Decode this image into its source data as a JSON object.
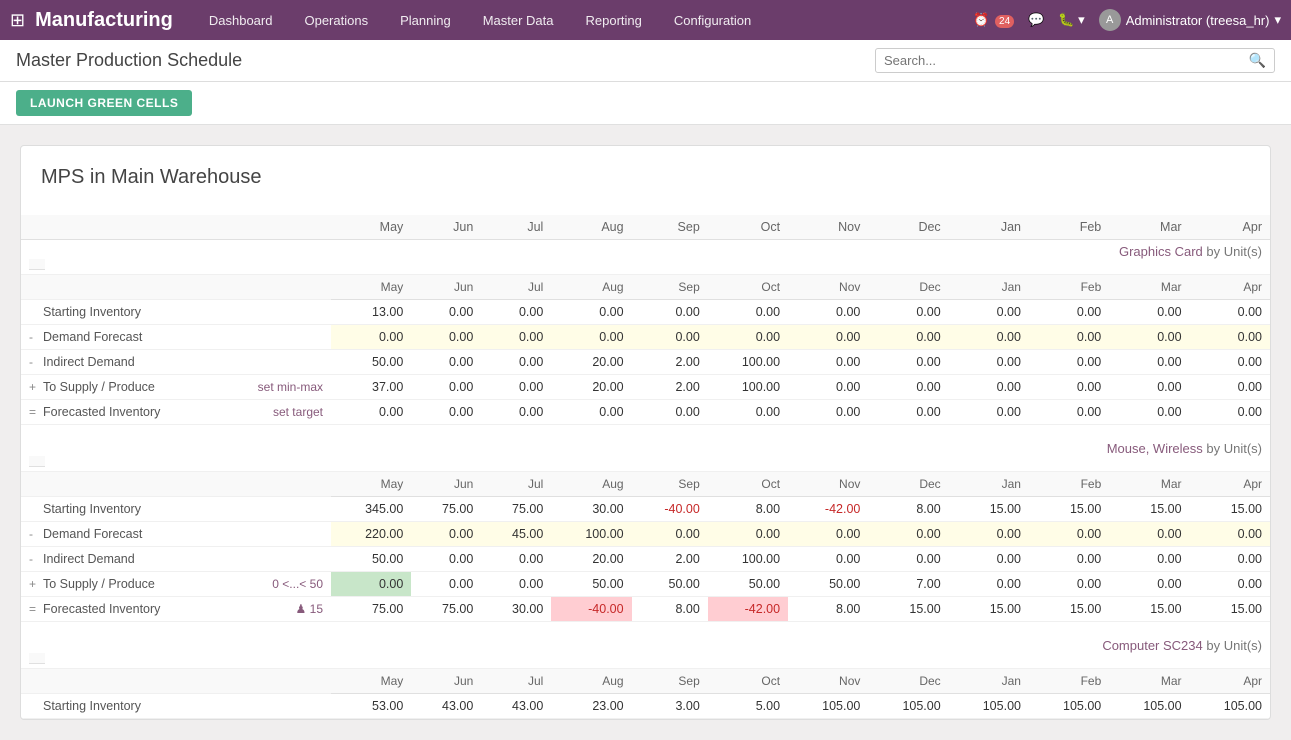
{
  "app": {
    "grid_icon": "⊞",
    "name": "Manufacturing"
  },
  "nav": {
    "items": [
      {
        "label": "Dashboard",
        "key": "dashboard"
      },
      {
        "label": "Operations",
        "key": "operations"
      },
      {
        "label": "Planning",
        "key": "planning"
      },
      {
        "label": "Master Data",
        "key": "master-data"
      },
      {
        "label": "Reporting",
        "key": "reporting"
      },
      {
        "label": "Configuration",
        "key": "configuration"
      }
    ]
  },
  "topright": {
    "activity_count": "24",
    "user_label": "Administrator (treesa_hr)",
    "user_initials": "A"
  },
  "page": {
    "title": "Master Production Schedule",
    "search_placeholder": "Search..."
  },
  "toolbar": {
    "launch_label": "LAUNCH GREEN CELLS"
  },
  "section": {
    "title": "MPS in Main Warehouse"
  },
  "columns": [
    "May",
    "Jun",
    "Jul",
    "Aug",
    "Sep",
    "Oct",
    "Nov",
    "Dec",
    "Jan",
    "Feb",
    "Mar",
    "Apr"
  ],
  "products": [
    {
      "name": "Graphics Card",
      "unit": "Unit(s)",
      "rows": [
        {
          "label": "Starting Inventory",
          "prefix": "",
          "action": "",
          "values": [
            "13.00",
            "0.00",
            "0.00",
            "0.00",
            "0.00",
            "0.00",
            "0.00",
            "0.00",
            "0.00",
            "0.00",
            "0.00",
            "0.00"
          ],
          "highlights": []
        },
        {
          "label": "Demand Forecast",
          "prefix": "-",
          "action": "",
          "values": [
            "0.00",
            "0.00",
            "0.00",
            "0.00",
            "0.00",
            "0.00",
            "0.00",
            "0.00",
            "0.00",
            "0.00",
            "0.00",
            "0.00"
          ],
          "highlights": [
            0,
            1,
            2,
            3,
            4,
            5,
            6,
            7,
            8,
            9,
            10,
            11
          ],
          "highlight_type": "yellow"
        },
        {
          "label": "Indirect Demand",
          "prefix": "-",
          "action": "",
          "values": [
            "50.00",
            "0.00",
            "0.00",
            "20.00",
            "2.00",
            "100.00",
            "0.00",
            "0.00",
            "0.00",
            "0.00",
            "0.00",
            "0.00"
          ],
          "highlights": []
        },
        {
          "label": "To Supply / Produce",
          "prefix": "+",
          "action": "set min-max",
          "values": [
            "37.00",
            "0.00",
            "0.00",
            "20.00",
            "2.00",
            "100.00",
            "0.00",
            "0.00",
            "0.00",
            "0.00",
            "0.00",
            "0.00"
          ],
          "highlights": []
        },
        {
          "label": "Forecasted Inventory",
          "prefix": "=",
          "action": "set target",
          "values": [
            "0.00",
            "0.00",
            "0.00",
            "0.00",
            "0.00",
            "0.00",
            "0.00",
            "0.00",
            "0.00",
            "0.00",
            "0.00",
            "0.00"
          ],
          "highlights": []
        }
      ]
    },
    {
      "name": "Mouse, Wireless",
      "unit": "Unit(s)",
      "rows": [
        {
          "label": "Starting Inventory",
          "prefix": "",
          "action": "",
          "values": [
            "345.00",
            "75.00",
            "75.00",
            "30.00",
            "-40.00",
            "8.00",
            "-42.00",
            "8.00",
            "15.00",
            "15.00",
            "15.00",
            "15.00"
          ],
          "highlights": []
        },
        {
          "label": "Demand Forecast",
          "prefix": "-",
          "action": "",
          "values": [
            "220.00",
            "0.00",
            "45.00",
            "100.00",
            "0.00",
            "0.00",
            "0.00",
            "0.00",
            "0.00",
            "0.00",
            "0.00",
            "0.00"
          ],
          "highlights": [
            0,
            2,
            3
          ],
          "highlight_type": "yellow",
          "all_yellow": [
            0,
            1,
            2,
            3,
            4,
            5,
            6,
            7,
            8,
            9,
            10,
            11
          ]
        },
        {
          "label": "Indirect Demand",
          "prefix": "-",
          "action": "",
          "values": [
            "50.00",
            "0.00",
            "0.00",
            "20.00",
            "2.00",
            "100.00",
            "0.00",
            "0.00",
            "0.00",
            "0.00",
            "0.00",
            "0.00"
          ],
          "highlights": []
        },
        {
          "label": "To Supply / Produce",
          "prefix": "+",
          "action": "0 <...< 50",
          "values": [
            "0.00",
            "0.00",
            "0.00",
            "50.00",
            "50.00",
            "50.00",
            "50.00",
            "7.00",
            "0.00",
            "0.00",
            "0.00",
            "0.00"
          ],
          "highlights": [
            0
          ],
          "highlight_type": "green"
        },
        {
          "label": "Forecasted Inventory",
          "prefix": "=",
          "action": "♟ 15",
          "values": [
            "75.00",
            "75.00",
            "30.00",
            "-40.00",
            "8.00",
            "-42.00",
            "8.00",
            "15.00",
            "15.00",
            "15.00",
            "15.00",
            "15.00"
          ],
          "neg_highlights": [
            3,
            5
          ],
          "highlights": []
        }
      ]
    },
    {
      "name": "Computer SC234",
      "unit": "Unit(s)",
      "rows": [
        {
          "label": "Starting Inventory",
          "prefix": "",
          "action": "",
          "values": [
            "53.00",
            "43.00",
            "43.00",
            "23.00",
            "3.00",
            "5.00",
            "105.00",
            "105.00",
            "105.00",
            "105.00",
            "105.00",
            "105.00"
          ],
          "highlights": []
        }
      ]
    }
  ]
}
